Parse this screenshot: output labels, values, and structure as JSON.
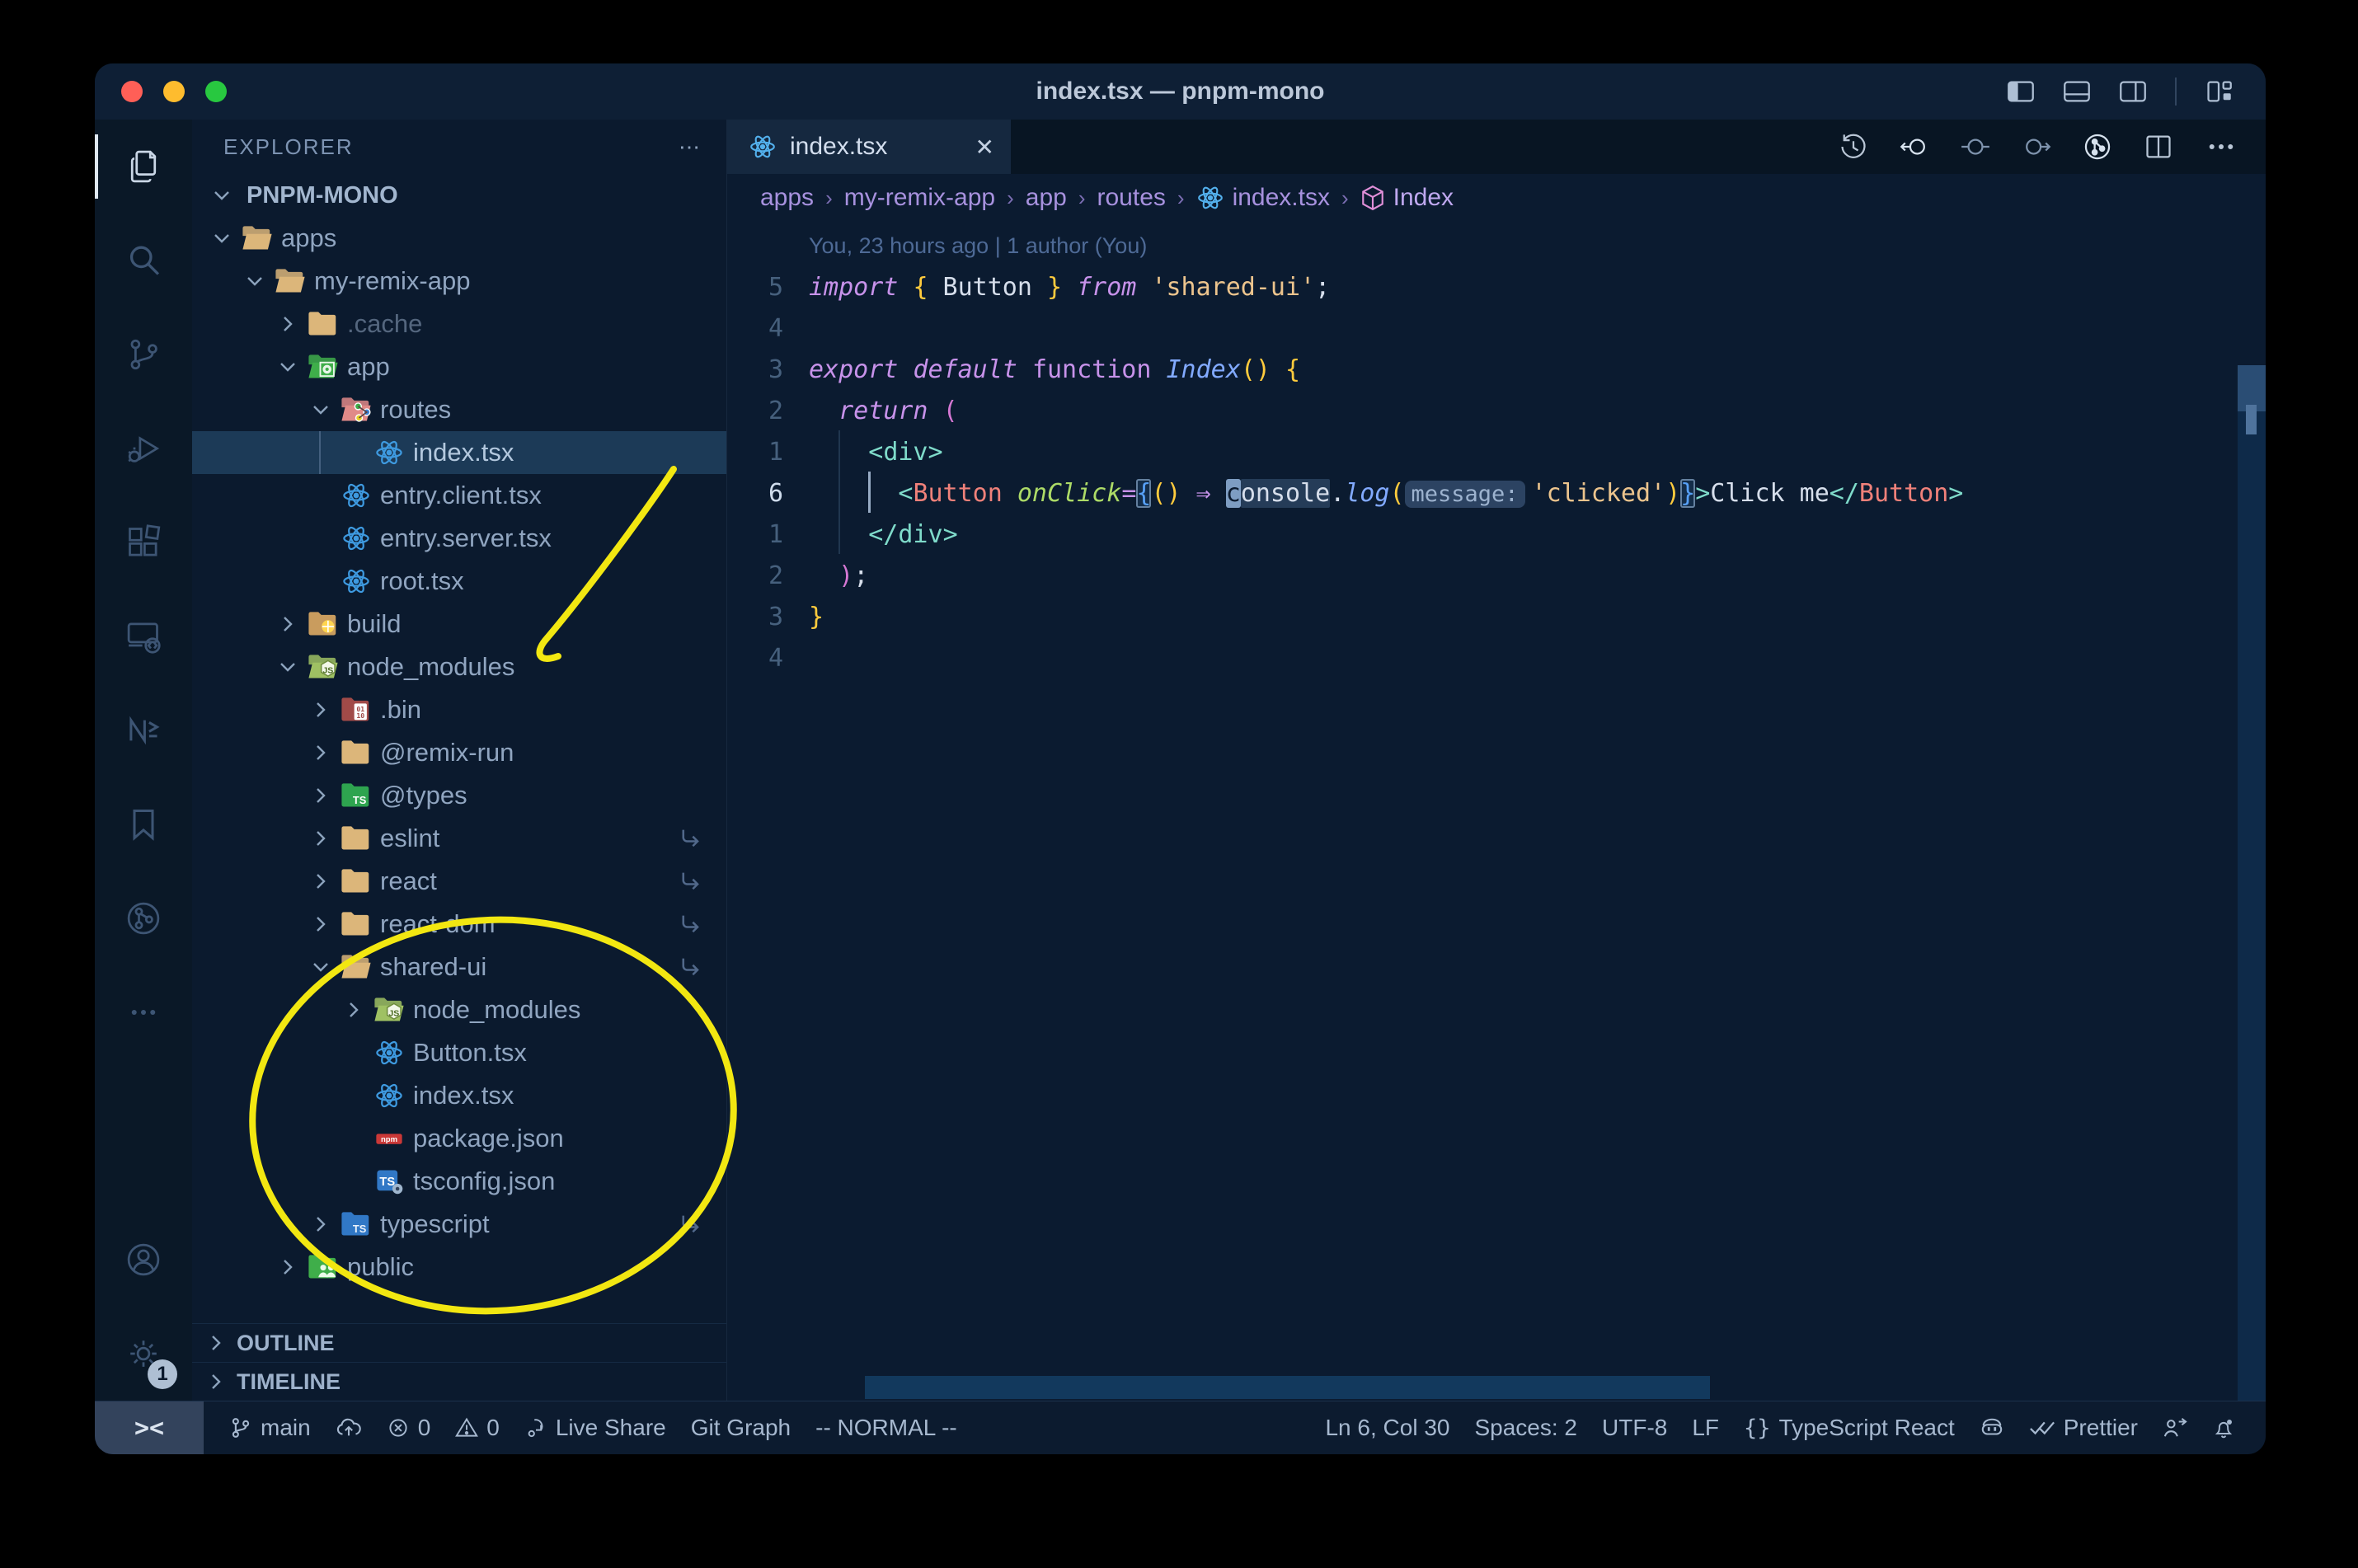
{
  "window": {
    "title": "index.tsx — pnpm-mono"
  },
  "titlebar": {
    "layout_icons": [
      "toggle-primary-sidebar-icon",
      "toggle-panel-icon",
      "toggle-secondary-sidebar-icon",
      "customize-layout-icon"
    ]
  },
  "activity_bar": {
    "items": [
      {
        "name": "explorer",
        "icon": "files-icon",
        "active": true
      },
      {
        "name": "search",
        "icon": "search-icon"
      },
      {
        "name": "source-control",
        "icon": "source-control-icon"
      },
      {
        "name": "run-debug",
        "icon": "run-debug-icon"
      },
      {
        "name": "extensions",
        "icon": "extensions-icon"
      },
      {
        "name": "remote-explorer",
        "icon": "remote-explorer-icon"
      },
      {
        "name": "nx-console",
        "icon": "nx-console-icon"
      },
      {
        "name": "bookmarks",
        "icon": "bookmarks-icon"
      },
      {
        "name": "git-graph",
        "icon": "git-graph-icon"
      },
      {
        "name": "more-views",
        "icon": "ellipsis-icon"
      }
    ],
    "bottom": [
      {
        "name": "accounts",
        "icon": "account-icon"
      },
      {
        "name": "settings",
        "icon": "gear-icon",
        "badge": "1"
      }
    ]
  },
  "sidebar": {
    "header": "EXPLORER",
    "project": "PNPM-MONO",
    "tree": [
      {
        "label": "apps",
        "icon": "folder-open-tan",
        "depth": 1,
        "state": "open"
      },
      {
        "label": "my-remix-app",
        "icon": "folder-open-tan",
        "depth": 2,
        "state": "open"
      },
      {
        "label": ".cache",
        "icon": "folder-tan",
        "depth": 3,
        "state": "closed",
        "dimmed": true
      },
      {
        "label": "app",
        "icon": "folder-app",
        "depth": 3,
        "state": "open"
      },
      {
        "label": "routes",
        "icon": "folder-routes",
        "depth": 4,
        "state": "open"
      },
      {
        "label": "index.tsx",
        "icon": "react-file",
        "depth": 5,
        "state": "none",
        "selected": true
      },
      {
        "label": "entry.client.tsx",
        "icon": "react-file",
        "depth": 4,
        "state": "none"
      },
      {
        "label": "entry.server.tsx",
        "icon": "react-file",
        "depth": 4,
        "state": "none"
      },
      {
        "label": "root.tsx",
        "icon": "react-file",
        "depth": 4,
        "state": "none"
      },
      {
        "label": "build",
        "icon": "folder-build",
        "depth": 3,
        "state": "closed"
      },
      {
        "label": "node_modules",
        "icon": "folder-node",
        "depth": 3,
        "state": "open"
      },
      {
        "label": ".bin",
        "icon": "folder-bin",
        "depth": 4,
        "state": "closed"
      },
      {
        "label": "@remix-run",
        "icon": "folder-tan",
        "depth": 4,
        "state": "closed"
      },
      {
        "label": "@types",
        "icon": "folder-types",
        "depth": 4,
        "state": "closed"
      },
      {
        "label": "eslint",
        "icon": "folder-tan",
        "depth": 4,
        "state": "closed",
        "symlink": true
      },
      {
        "label": "react",
        "icon": "folder-tan",
        "depth": 4,
        "state": "closed",
        "symlink": true
      },
      {
        "label": "react-dom",
        "icon": "folder-tan",
        "depth": 4,
        "state": "closed",
        "symlink": true
      },
      {
        "label": "shared-ui",
        "icon": "folder-open-tan",
        "depth": 4,
        "state": "open",
        "symlink": true
      },
      {
        "label": "node_modules",
        "icon": "folder-node",
        "depth": 5,
        "state": "closed"
      },
      {
        "label": "Button.tsx",
        "icon": "react-file",
        "depth": 5,
        "state": "none"
      },
      {
        "label": "index.tsx",
        "icon": "react-file",
        "depth": 5,
        "state": "none"
      },
      {
        "label": "package.json",
        "icon": "npm-file",
        "depth": 5,
        "state": "none"
      },
      {
        "label": "tsconfig.json",
        "icon": "tsconfig-file",
        "depth": 5,
        "state": "none"
      },
      {
        "label": "typescript",
        "icon": "folder-ts",
        "depth": 4,
        "state": "closed",
        "symlink": true
      },
      {
        "label": "public",
        "icon": "folder-public",
        "depth": 3,
        "state": "closed"
      }
    ],
    "panels": [
      {
        "label": "OUTLINE"
      },
      {
        "label": "TIMELINE"
      }
    ]
  },
  "editor": {
    "tab": {
      "label": "index.tsx",
      "icon": "react-icon",
      "close": "✕"
    },
    "actions": [
      {
        "name": "timeline-history",
        "icon": "history-icon",
        "tone": "mid"
      },
      {
        "name": "previous-change",
        "icon": "prev-change-icon",
        "tone": "bright"
      },
      {
        "name": "open-change",
        "icon": "open-change-icon",
        "tone": "dim"
      },
      {
        "name": "next-change",
        "icon": "next-change-icon",
        "tone": "dim"
      },
      {
        "name": "commit-graph",
        "icon": "commit-graph-icon",
        "tone": "bright"
      },
      {
        "name": "split-editor",
        "icon": "split-editor-icon",
        "tone": "mid"
      },
      {
        "name": "more-actions",
        "icon": "ellipsis-icon",
        "tone": "mid"
      }
    ],
    "breadcrumbs": [
      {
        "label": "apps"
      },
      {
        "label": "my-remix-app"
      },
      {
        "label": "app"
      },
      {
        "label": "routes"
      },
      {
        "label": "index.tsx",
        "icon": "react-icon"
      },
      {
        "label": "Index",
        "icon": "symbol-module-icon",
        "last": true
      }
    ],
    "blame": "You, 23 hours ago | 1 author (You)",
    "code_lines": [
      {
        "blame": true
      },
      {
        "num": "5",
        "tokens": [
          [
            "k",
            "import"
          ],
          [
            "p",
            " "
          ],
          [
            "b1",
            "{"
          ],
          [
            "p",
            " Button "
          ],
          [
            "b1",
            "}"
          ],
          [
            "p",
            " "
          ],
          [
            "k",
            "from"
          ],
          [
            "p",
            " "
          ],
          [
            "s",
            "'shared-ui'"
          ],
          [
            "p",
            ";"
          ]
        ]
      },
      {
        "num": "4",
        "tokens": []
      },
      {
        "num": "3",
        "tokens": [
          [
            "k",
            "export"
          ],
          [
            "p",
            " "
          ],
          [
            "k",
            "default"
          ],
          [
            "p",
            " "
          ],
          [
            "kf",
            "function"
          ],
          [
            "p",
            " "
          ],
          [
            "f",
            "Index"
          ],
          [
            "b1",
            "("
          ],
          [
            "b1",
            ")"
          ],
          [
            "p",
            " "
          ],
          [
            "b1",
            "{"
          ]
        ]
      },
      {
        "num": "2",
        "tokens": [
          [
            "p",
            "  "
          ],
          [
            "k",
            "return"
          ],
          [
            "p",
            " "
          ],
          [
            "b2",
            "("
          ]
        ]
      },
      {
        "num": "1",
        "tokens": [
          [
            "p",
            "  "
          ],
          [
            "g",
            ""
          ],
          [
            "p",
            "  "
          ],
          [
            "tb",
            "<"
          ],
          [
            "tb",
            "div"
          ],
          [
            "tb",
            ">"
          ]
        ]
      },
      {
        "num": "6",
        "active": true,
        "tokens": [
          [
            "p",
            "  "
          ],
          [
            "g",
            ""
          ],
          [
            "p",
            "  "
          ],
          [
            "ig",
            ""
          ],
          [
            "p",
            "  "
          ],
          [
            "tb",
            "<"
          ],
          [
            "t",
            "Button"
          ],
          [
            "p",
            " "
          ],
          [
            "a",
            "onClick"
          ],
          [
            "o",
            "="
          ],
          [
            "b3 bm",
            "{"
          ],
          [
            "b1",
            "("
          ],
          [
            "b1",
            ")"
          ],
          [
            "p",
            " "
          ],
          [
            "o",
            "⇒"
          ],
          [
            "p",
            " "
          ],
          [
            "cur",
            "c"
          ],
          [
            "wh",
            "onsole"
          ],
          [
            "p",
            "."
          ],
          [
            "f",
            "log"
          ],
          [
            "b1",
            "("
          ],
          [
            "hint",
            "message:"
          ],
          [
            "s",
            "'clicked'"
          ],
          [
            "b1",
            ")"
          ],
          [
            "b3 bm",
            "}"
          ],
          [
            "tb",
            ">"
          ],
          [
            "p",
            "Click me"
          ],
          [
            "tb",
            "</"
          ],
          [
            "t",
            "Button"
          ],
          [
            "tb",
            ">"
          ]
        ]
      },
      {
        "num": "1",
        "tokens": [
          [
            "p",
            "  "
          ],
          [
            "g",
            ""
          ],
          [
            "p",
            "  "
          ],
          [
            "tb",
            "</"
          ],
          [
            "tb",
            "div"
          ],
          [
            "tb",
            ">"
          ]
        ]
      },
      {
        "num": "2",
        "tokens": [
          [
            "p",
            "  "
          ],
          [
            "b2",
            ")"
          ],
          [
            "p",
            ";"
          ]
        ]
      },
      {
        "num": "3",
        "tokens": [
          [
            "b1",
            "}"
          ]
        ]
      },
      {
        "num": "4",
        "tokens": []
      }
    ]
  },
  "status_bar": {
    "left": [
      {
        "name": "remote-indicator",
        "icon": "remote-icon",
        "text": "><",
        "remote": true
      },
      {
        "name": "git-branch",
        "icon": "branch-icon",
        "text": "main"
      },
      {
        "name": "sync",
        "icon": "cloud-upload-icon",
        "text": ""
      },
      {
        "name": "errors",
        "icon": "error-icon",
        "text": "0"
      },
      {
        "name": "warnings",
        "icon": "warning-icon",
        "text": "0"
      },
      {
        "name": "live-share",
        "icon": "live-share-icon",
        "text": "Live Share"
      },
      {
        "name": "git-graph",
        "text": "Git Graph"
      },
      {
        "name": "vim-mode",
        "text": "-- NORMAL --"
      }
    ],
    "right": [
      {
        "name": "cursor-position",
        "text": "Ln 6, Col 30"
      },
      {
        "name": "indentation",
        "text": "Spaces: 2"
      },
      {
        "name": "encoding",
        "text": "UTF-8"
      },
      {
        "name": "eol",
        "text": "LF"
      },
      {
        "name": "language-mode",
        "icon": "braces-icon",
        "text": "TypeScript React"
      },
      {
        "name": "copilot",
        "icon": "copilot-icon",
        "text": ""
      },
      {
        "name": "prettier",
        "icon": "double-check-icon",
        "text": "Prettier"
      },
      {
        "name": "feedback",
        "icon": "feedback-icon",
        "text": ""
      },
      {
        "name": "notifications",
        "icon": "bell-dot-icon",
        "text": ""
      }
    ]
  },
  "annotations": {
    "color": "#f2e711",
    "arrow": "hand-drawn-arrow",
    "ellipse": "hand-drawn-ellipse"
  }
}
